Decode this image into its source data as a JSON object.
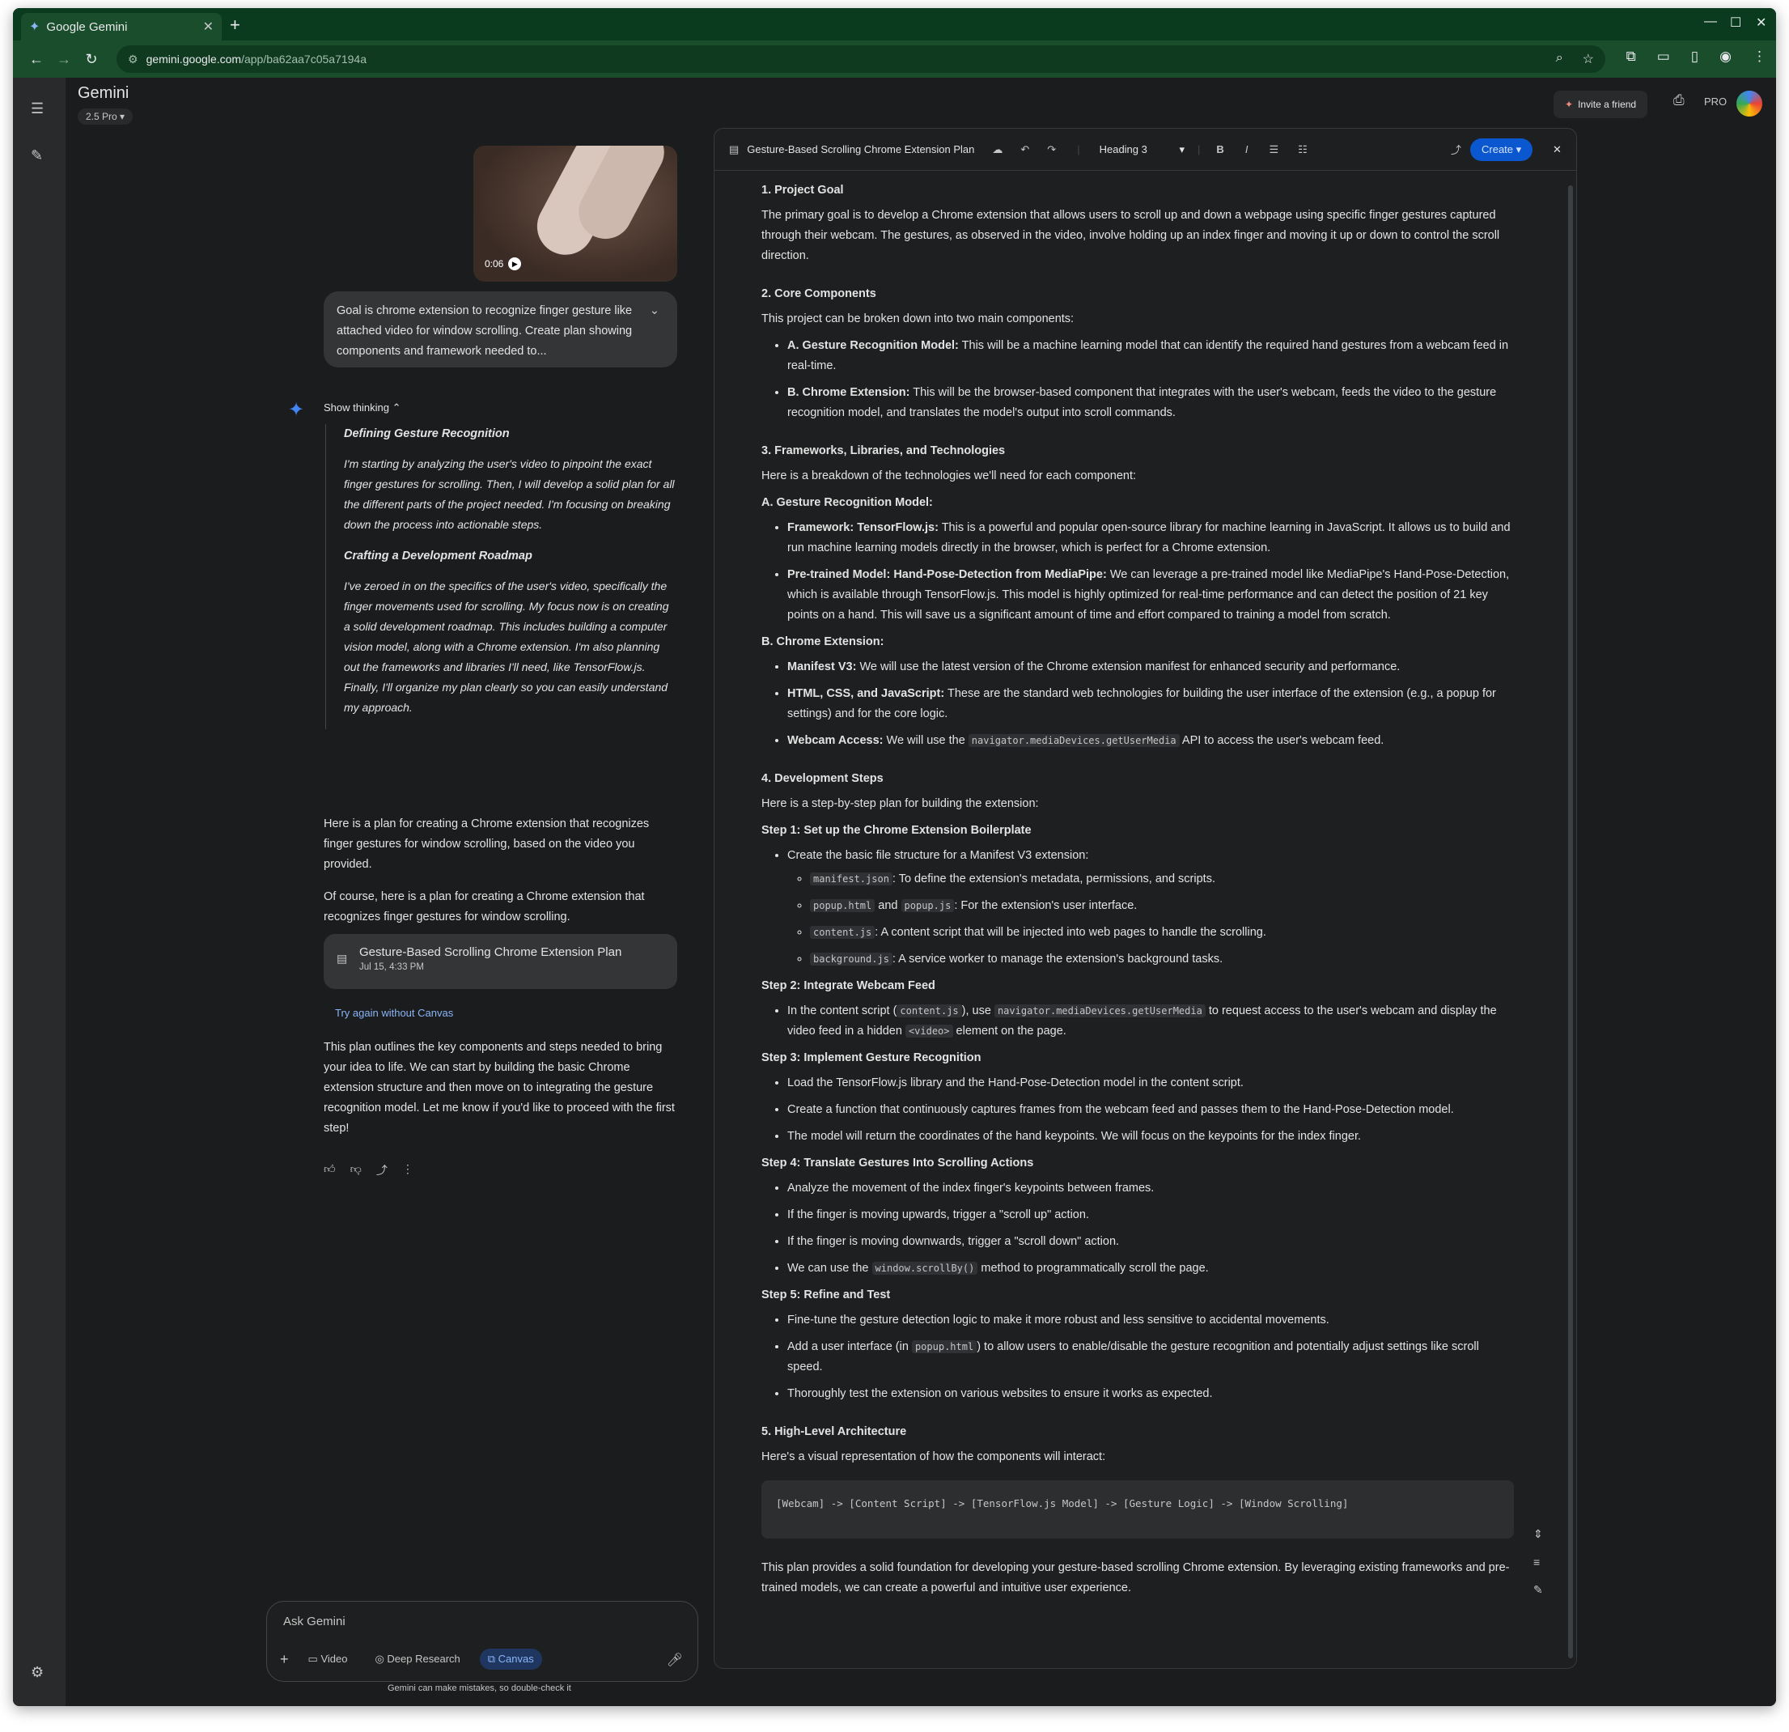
{
  "browser": {
    "tab_title": "Google Gemini",
    "url_host": "gemini.google.com",
    "url_path": "/app/ba62aa7c05a7194a"
  },
  "app": {
    "name": "Gemini",
    "model": "2.5 Pro",
    "invite_label": "Invite a friend",
    "pro_badge": "PRO"
  },
  "chat": {
    "video_time": "0:06",
    "user_query": "Goal is chrome extension to recognize finger gesture like attached video for window scrolling. Create plan showing components and framework needed to...",
    "show_thinking": "Show thinking",
    "thinking": [
      {
        "heading": "Defining Gesture Recognition",
        "text": "I'm starting by analyzing the user's video to pinpoint the exact finger gestures for scrolling. Then, I will develop a solid plan for all the different parts of the project needed. I'm focusing on breaking down the process into actionable steps."
      },
      {
        "heading": "Crafting a Development Roadmap",
        "text": "I've zeroed in on the specifics of the user's video, specifically the finger movements used for scrolling. My focus now is on creating a solid development roadmap. This includes building a computer vision model, along with a Chrome extension. I'm also planning out the frameworks and libraries I'll need, like TensorFlow.js. Finally, I'll organize my plan clearly so you can easily understand my approach."
      }
    ],
    "response_1": "Here is a plan for creating a Chrome extension that recognizes finger gestures for window scrolling, based on the video you provided.",
    "response_2": "Of course, here is a plan for creating a Chrome extension that recognizes finger gestures for window scrolling.",
    "doc_card_title": "Gesture-Based Scrolling Chrome Extension Plan",
    "doc_card_date": "Jul 15, 4:33 PM",
    "try_again": "Try again without Canvas",
    "response_3": "This plan outlines the key components and steps needed to bring your idea to life. We can start by building the basic Chrome extension structure and then move on to integrating the gesture recognition model. Let me know if you'd like to proceed with the first step!",
    "input_placeholder": "Ask Gemini",
    "tools": [
      "Video",
      "Deep Research",
      "Canvas"
    ],
    "disclaimer": "Gemini can make mistakes, so double-check it"
  },
  "canvas": {
    "title": "Gesture-Based Scrolling Chrome Extension Plan",
    "style_select": "Heading 3",
    "create_label": "Create",
    "h1": "1. Project Goal",
    "goal": "The primary goal is to develop a Chrome extension that allows users to scroll up and down a webpage using specific finger gestures captured through their webcam. The gestures, as observed in the video, involve holding up an index finger and moving it up or down to control the scroll direction.",
    "h2": "2. Core Components",
    "core_intro": "This project can be broken down into two main components:",
    "core_a_b": "A. Gesture Recognition Model:",
    "core_a": "This will be a machine learning model that can identify the required hand gestures from a webcam feed in real-time.",
    "core_b_b": "B. Chrome Extension:",
    "core_b": "This will be the browser-based component that integrates with the user's webcam, feeds the video to the gesture recognition model, and translates the model's output into scroll commands.",
    "h3": "3. Frameworks, Libraries, and Technologies",
    "fw_intro": "Here is a breakdown of the technologies we'll need for each component:",
    "fw_a": "A. Gesture Recognition Model:",
    "fw_a1_b": "Framework: TensorFlow.js:",
    "fw_a1": "This is a powerful and popular open-source library for machine learning in JavaScript. It allows us to build and run machine learning models directly in the browser, which is perfect for a Chrome extension.",
    "fw_a2_b": "Pre-trained Model: Hand-Pose-Detection from MediaPipe:",
    "fw_a2": "We can leverage a pre-trained model like MediaPipe's Hand-Pose-Detection, which is available through TensorFlow.js. This model is highly optimized for real-time performance and can detect the position of 21 key points on a hand. This will save us a significant amount of time and effort compared to training a model from scratch.",
    "fw_b": "B. Chrome Extension:",
    "fw_b1_b": "Manifest V3:",
    "fw_b1": "We will use the latest version of the Chrome extension manifest for enhanced security and performance.",
    "fw_b2_b": "HTML, CSS, and JavaScript:",
    "fw_b2": "These are the standard web technologies for building the user interface of the extension (e.g., a popup for settings) and for the core logic.",
    "fw_b3_b": "Webcam Access:",
    "fw_b3_pre": "We will use the",
    "fw_b3_code": "navigator.mediaDevices.getUserMedia",
    "fw_b3_post": "API to access the user's webcam feed.",
    "h4": "4. Development Steps",
    "dev_intro": "Here is a step-by-step plan for building the extension:",
    "s1": "Step 1: Set up the Chrome Extension Boilerplate",
    "s1_item": "Create the basic file structure for a Manifest V3 extension:",
    "s1_files": [
      {
        "code": "manifest.json",
        "text": ": To define the extension's metadata, permissions, and scripts."
      },
      {
        "code": "popup.html",
        "mid": "and",
        "code2": "popup.js",
        "text": ": For the extension's user interface."
      },
      {
        "code": "content.js",
        "text": ": A content script that will be injected into web pages to handle the scrolling."
      },
      {
        "code": "background.js",
        "text": ": A service worker to manage the extension's background tasks."
      }
    ],
    "s2": "Step 2: Integrate Webcam Feed",
    "s2_a": "In the content script (",
    "s2_c1": "content.js",
    "s2_b": "), use",
    "s2_c2": "navigator.mediaDevices.getUserMedia",
    "s2_c": "to request access to the user's webcam and display the video feed in a hidden",
    "s2_c3": "<video>",
    "s2_d": "element on the page.",
    "s3": "Step 3: Implement Gesture Recognition",
    "s3_items": [
      "Load the TensorFlow.js library and the Hand-Pose-Detection model in the content script.",
      "Create a function that continuously captures frames from the webcam feed and passes them to the Hand-Pose-Detection model.",
      "The model will return the coordinates of the hand keypoints. We will focus on the keypoints for the index finger."
    ],
    "s4": "Step 4: Translate Gestures Into Scrolling Actions",
    "s4_items": [
      "Analyze the movement of the index finger's keypoints between frames.",
      "If the finger is moving upwards, trigger a \"scroll up\" action.",
      "If the finger is moving downwards, trigger a \"scroll down\" action."
    ],
    "s4_last_pre": "We can use the",
    "s4_last_code": "window.scrollBy()",
    "s4_last_post": "method to programmatically scroll the page.",
    "s5": "Step 5: Refine and Test",
    "s5_1": "Fine-tune the gesture detection logic to make it more robust and less sensitive to accidental movements.",
    "s5_2_pre": "Add a user interface (in",
    "s5_2_code": "popup.html",
    "s5_2_post": ") to allow users to enable/disable the gesture recognition and potentially adjust settings like scroll speed.",
    "s5_3": "Thoroughly test the extension on various websites to ensure it works as expected.",
    "h5": "5. High-Level Architecture",
    "arch_intro": "Here's a visual representation of how the components will interact:",
    "arch_code": "[Webcam] -> [Content Script] -> [TensorFlow.js Model] -> [Gesture Logic] -> [Window Scrolling]",
    "closing": "This plan provides a solid foundation for developing your gesture-based scrolling Chrome extension. By leveraging existing frameworks and pre-trained models, we can create a powerful and intuitive user experience."
  }
}
